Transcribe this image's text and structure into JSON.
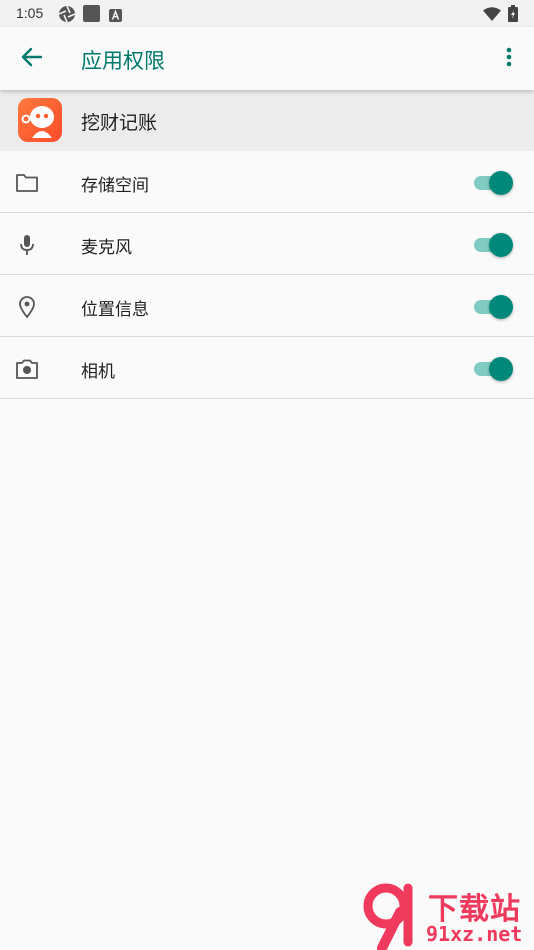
{
  "status_bar": {
    "time": "1:05"
  },
  "app_bar": {
    "title": "应用权限"
  },
  "app": {
    "name": "挖财记账"
  },
  "permissions": [
    {
      "label": "存储空间",
      "icon": "folder-icon",
      "enabled": true
    },
    {
      "label": "麦克风",
      "icon": "microphone-icon",
      "enabled": true
    },
    {
      "label": "位置信息",
      "icon": "location-icon",
      "enabled": true
    },
    {
      "label": "相机",
      "icon": "camera-icon",
      "enabled": true
    }
  ],
  "watermark": {
    "top": "下载站",
    "bottom": "91xz.net"
  },
  "colors": {
    "accent": "#00796b",
    "toggle_on": "#00897b",
    "toggle_track": "#80cbc4"
  }
}
